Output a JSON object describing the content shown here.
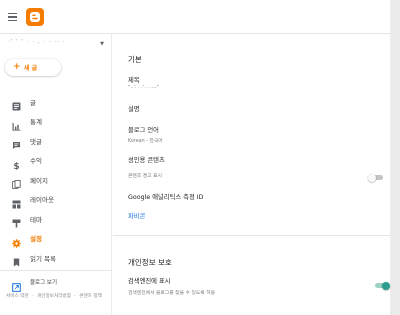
{
  "app": {
    "name": "Blogger",
    "brand_color": "#f57c00",
    "icons": {
      "menu": "hamburger-icon",
      "logo": "blogger-logo"
    }
  },
  "sidebar": {
    "blog_name": "·' ˈ ’ · · ‚ · · ·· ·",
    "new_post_plus": "+",
    "new_post_label": "새 글",
    "items": [
      {
        "label": "글",
        "icon": "posts-icon"
      },
      {
        "label": "통계",
        "icon": "stats-icon"
      },
      {
        "label": "댓글",
        "icon": "comments-icon"
      },
      {
        "label": "수익",
        "icon": "earnings-icon"
      },
      {
        "label": "페이지",
        "icon": "pages-icon"
      },
      {
        "label": "레이아웃",
        "icon": "layout-icon"
      },
      {
        "label": "테마",
        "icon": "theme-icon"
      },
      {
        "label": "설정",
        "icon": "settings-icon",
        "active": true
      },
      {
        "label": "읽기 목록",
        "icon": "reading-list-icon"
      }
    ],
    "view_blog_label": "블로그 보기",
    "footer": [
      "서비스 약관",
      "·",
      "개인정보처리방침",
      "·",
      "콘텐츠 정책"
    ]
  },
  "main": {
    "basic_section_title": "기본",
    "title_label": "제목",
    "title_value": "“··’· · ·’· · ····”",
    "description_label": "설명",
    "language_label": "블로그 언어",
    "language_value": "Korean - 한국어",
    "adult_label": "성인용 콘텐츠",
    "adult_desc": "콘텐츠 경고 표시",
    "adult_toggle": false,
    "ga_label": "Google 애널리틱스 측정 ID",
    "favicon_label": "파비콘",
    "privacy_section_title": "개인정보 보호",
    "search_label": "검색엔진에 표시",
    "search_desc": "검색엔진에서 블로그를 찾을 수 있도록 허용",
    "search_toggle": true,
    "toggle_on_color": "#2a9d8f"
  }
}
